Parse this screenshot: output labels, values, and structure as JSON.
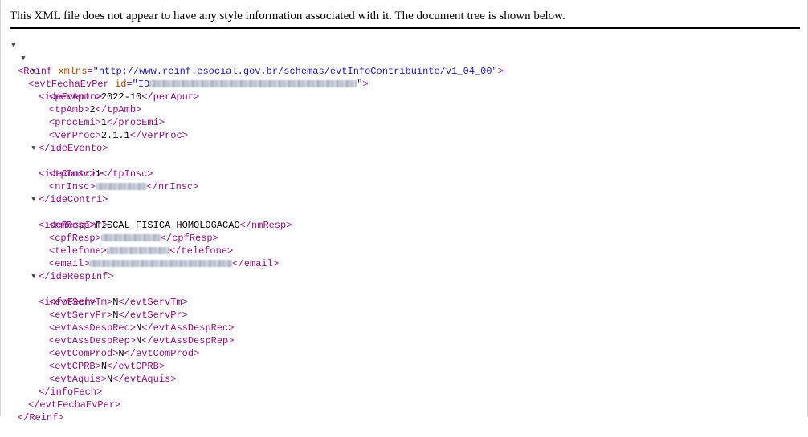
{
  "header": {
    "notice": "This XML file does not appear to have any style information associated with it. The document tree is shown below."
  },
  "toggle_glyph": "▼",
  "tree": {
    "reinf_open": "<Reinf",
    "reinf_attr": "xmlns",
    "reinf_attr_value": "\"http://www.reinf.esocial.gov.br/schemas/evtInfoContribuinte/v1_04_00\"",
    "reinf_close_bracket": ">",
    "evt_open": "<evtFechaEvPer",
    "evt_attr": "id",
    "evt_attr_value_prefix": "\"ID",
    "evt_attr_value_suffix": "\"",
    "evt_close_bracket": ">",
    "ideEvento_open": "<ideEvento>",
    "perApur_open": "<perApur>",
    "perApur": "2022-10",
    "perApur_close": "</perApur>",
    "tpAmb_open": "<tpAmb>",
    "tpAmb": "2",
    "tpAmb_close": "</tpAmb>",
    "procEmi_open": "<procEmi>",
    "procEmi": "1",
    "procEmi_close": "</procEmi>",
    "verProc_open": "<verProc>",
    "verProc": "2.1.1",
    "verProc_close": "</verProc>",
    "ideEvento_close": "</ideEvento>",
    "ideContri_open": "<ideContri>",
    "tpInsc_open": "<tpInsc>",
    "tpInsc": "1",
    "tpInsc_close": "</tpInsc>",
    "nrInsc_open": "<nrInsc>",
    "nrInsc_close": "</nrInsc>",
    "ideContri_close": "</ideContri>",
    "ideRespInf_open": "<ideRespInf>",
    "nmResp_open": "<nmResp>",
    "nmResp": "FISCAL FISICA HOMOLOGACAO",
    "nmResp_close": "</nmResp>",
    "cpfResp_open": "<cpfResp>",
    "cpfResp_close": "</cpfResp>",
    "telefone_open": "<telefone>",
    "telefone_close": "</telefone>",
    "email_open": "<email>",
    "email_close": "</email>",
    "ideRespInf_close": "</ideRespInf>",
    "infoFech_open": "<infoFech>",
    "evtServTm_open": "<evtServTm>",
    "evtServTm": "N",
    "evtServTm_close": "</evtServTm>",
    "evtServPr_open": "<evtServPr>",
    "evtServPr": "N",
    "evtServPr_close": "</evtServPr>",
    "evtAssDespRec_open": "<evtAssDespRec>",
    "evtAssDespRec": "N",
    "evtAssDespRec_close": "</evtAssDespRec>",
    "evtAssDespRep_open": "<evtAssDespRep>",
    "evtAssDespRep": "N",
    "evtAssDespRep_close": "</evtAssDespRep>",
    "evtComProd_open": "<evtComProd>",
    "evtComProd": "N",
    "evtComProd_close": "</evtComProd>",
    "evtCPRB_open": "<evtCPRB>",
    "evtCPRB": "N",
    "evtCPRB_close": "</evtCPRB>",
    "evtAquis_open": "<evtAquis>",
    "evtAquis": "N",
    "evtAquis_close": "</evtAquis>",
    "infoFech_close": "</infoFech>",
    "evt_close": "</evtFechaEvPer>",
    "reinf_close": "</Reinf>"
  },
  "colors": {
    "tag": "#881280",
    "attribute_name": "#994500",
    "attribute_value": "#1a1aa6",
    "text": "#000000"
  }
}
